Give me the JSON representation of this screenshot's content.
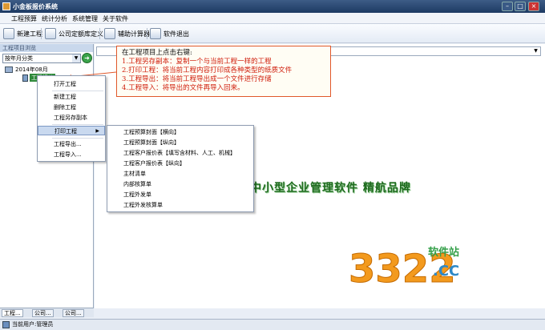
{
  "window": {
    "title": "小金板报价系统"
  },
  "menubar": {
    "items": [
      "工程预算",
      "统计分析",
      "系统管理",
      "关于软件"
    ]
  },
  "toolbar": {
    "new_project": "新建工程",
    "company_quota": "公司定额库定义",
    "calculator": "辅助计算器",
    "exit": "软件退出"
  },
  "left_panel": {
    "header": "工程项目浏览",
    "filter": "按年月分类",
    "tree_root": "2014年08月",
    "tree_child": "工程报价",
    "tabs": [
      "工程...",
      "公司...",
      "公司..."
    ]
  },
  "callout": {
    "title": "在工程项目上点击右键:",
    "lines": [
      "1.工程另存副本：复制一个与当前工程一样的工程",
      "2.打印工程：将当前工程内容打印成各种类型的纸质文件",
      "3.工程导出：将当前工程导出成一个文件进行存储",
      "4.工程导入：将导出的文件再导入回来。"
    ]
  },
  "context_menu": {
    "items": [
      "打开工程",
      "新建工程",
      "删除工程",
      "工程另存副本",
      "打印工程",
      "工程导出...",
      "工程导入..."
    ]
  },
  "submenu": {
    "items": [
      "工程预算封面【横向】",
      "工程预算封面【纵向】",
      "工程客户报价表【填写含材料、人工、机械】",
      "工程客户报价表【纵向】",
      "主材清单",
      "内部核算单",
      "工程外发单",
      "工程外发核算单"
    ]
  },
  "watermark": "中小型企业管理软件  精航品牌",
  "logo": {
    "number": "3322",
    "site": "软件站",
    "domain": ".CC"
  },
  "statusbar": {
    "text": "当前用户:管理员"
  }
}
